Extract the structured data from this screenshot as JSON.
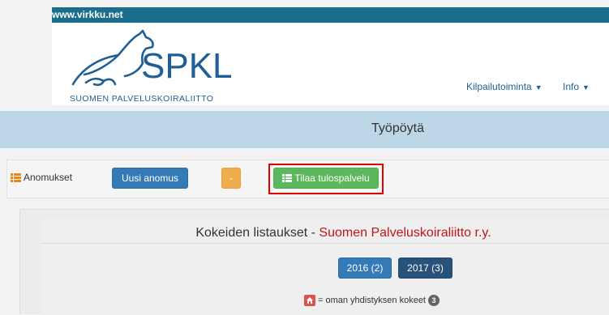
{
  "topbar": {
    "site": "www.virkku.net"
  },
  "brand": {
    "logo_text": "SPKL",
    "logo_subtitle": "SUOMEN PALVELUSKOIRALIITTO"
  },
  "nav": {
    "competitions": "Kilpailutoiminta",
    "info": "Info"
  },
  "page": {
    "title": "Työpöytä"
  },
  "toolbar": {
    "applications_label": "Anomukset",
    "new_application": "Uusi anomus",
    "orange_button": "-",
    "order_results": "Tilaa tulospalvelu"
  },
  "listing": {
    "title_prefix": "Kokeiden listaukset - ",
    "organization": "Suomen Palveluskoiraliitto r.y.",
    "years": [
      {
        "label": "2016 (2)"
      },
      {
        "label": "2017 (3)"
      }
    ],
    "legend_text": "= oman yhdistyksen kokeet",
    "legend_count": "3"
  },
  "colors": {
    "topbar": "#1a6e8c",
    "brand_blue": "#1f5f96",
    "primary": "#337ab7",
    "success": "#5cb85c",
    "warning": "#f0ad4e",
    "danger": "#d9534f",
    "org_red": "#c0161b",
    "highlight": "#e00000"
  }
}
